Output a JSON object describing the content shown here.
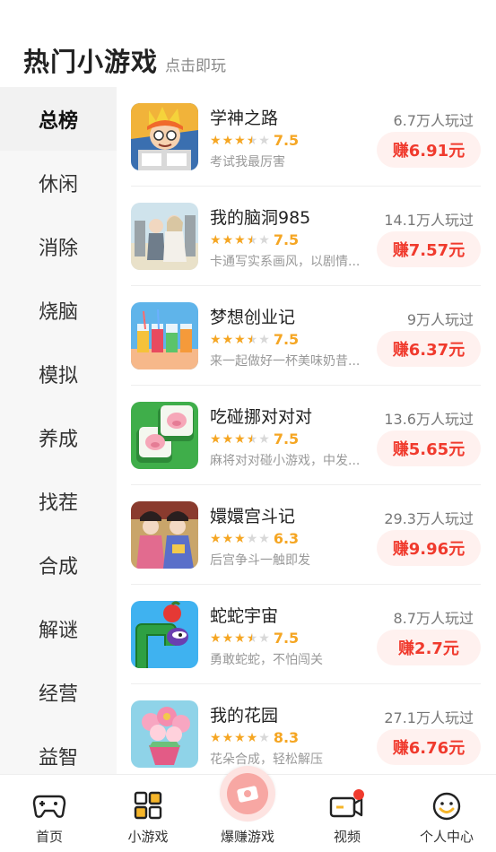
{
  "header": {
    "title": "热门小游戏",
    "subtitle": "点击即玩"
  },
  "sidebar": {
    "items": [
      {
        "label": "总榜",
        "active": true
      },
      {
        "label": "休闲"
      },
      {
        "label": "消除"
      },
      {
        "label": "烧脑"
      },
      {
        "label": "模拟"
      },
      {
        "label": "养成"
      },
      {
        "label": "找茬"
      },
      {
        "label": "合成"
      },
      {
        "label": "解谜"
      },
      {
        "label": "经营"
      },
      {
        "label": "益智"
      }
    ]
  },
  "games": [
    {
      "name": "学神之路",
      "rating": 3.5,
      "score": "7.5",
      "desc": "考试我最厉害",
      "plays": "6.7万人玩过",
      "earn": "赚6.91元",
      "icon": "cartoon-student-icon"
    },
    {
      "name": "我的脑洞985",
      "rating": 3.5,
      "score": "7.5",
      "desc": "卡通写实系画风，以剧情...",
      "plays": "14.1万人玩过",
      "earn": "赚7.57元",
      "icon": "sketch-couple-icon"
    },
    {
      "name": "梦想创业记",
      "rating": 3.5,
      "score": "7.5",
      "desc": "来一起做好一杯美味奶昔...",
      "plays": "9万人玩过",
      "earn": "赚6.37元",
      "icon": "drink-cups-icon"
    },
    {
      "name": "吃碰挪对对对",
      "rating": 3.5,
      "score": "7.5",
      "desc": "麻将对对碰小游戏，中发...",
      "plays": "13.6万人玩过",
      "earn": "赚5.65元",
      "icon": "mahjong-pig-icon"
    },
    {
      "name": "嬛嬛宫斗记",
      "rating": 3,
      "score": "6.3",
      "desc": "后宫争斗一触即发",
      "plays": "29.3万人玩过",
      "earn": "赚9.96元",
      "icon": "palace-ladies-icon"
    },
    {
      "name": "蛇蛇宇宙",
      "rating": 3.5,
      "score": "7.5",
      "desc": "勇敢蛇蛇，不怕闯关",
      "plays": "8.7万人玩过",
      "earn": "赚2.7元",
      "icon": "snake-apple-icon"
    },
    {
      "name": "我的花园",
      "rating": 4,
      "score": "8.3",
      "desc": "花朵合成，轻松解压",
      "plays": "27.1万人玩过",
      "earn": "赚6.76元",
      "icon": "flower-bouquet-icon"
    }
  ],
  "tabbar": {
    "items": [
      {
        "label": "首页",
        "icon": "gamepad-icon"
      },
      {
        "label": "小游戏",
        "icon": "grid-icon",
        "active": true
      },
      {
        "label": "爆赚游戏",
        "icon": "money-icon"
      },
      {
        "label": "视频",
        "icon": "video-camera-icon",
        "badge": true
      },
      {
        "label": "个人中心",
        "icon": "smiley-face-icon"
      }
    ]
  },
  "colors": {
    "accent": "#f03a2d",
    "star": "#f5a623",
    "earn_bg": "#fff1ef",
    "sidebar_bg": "#f7f7f7"
  }
}
